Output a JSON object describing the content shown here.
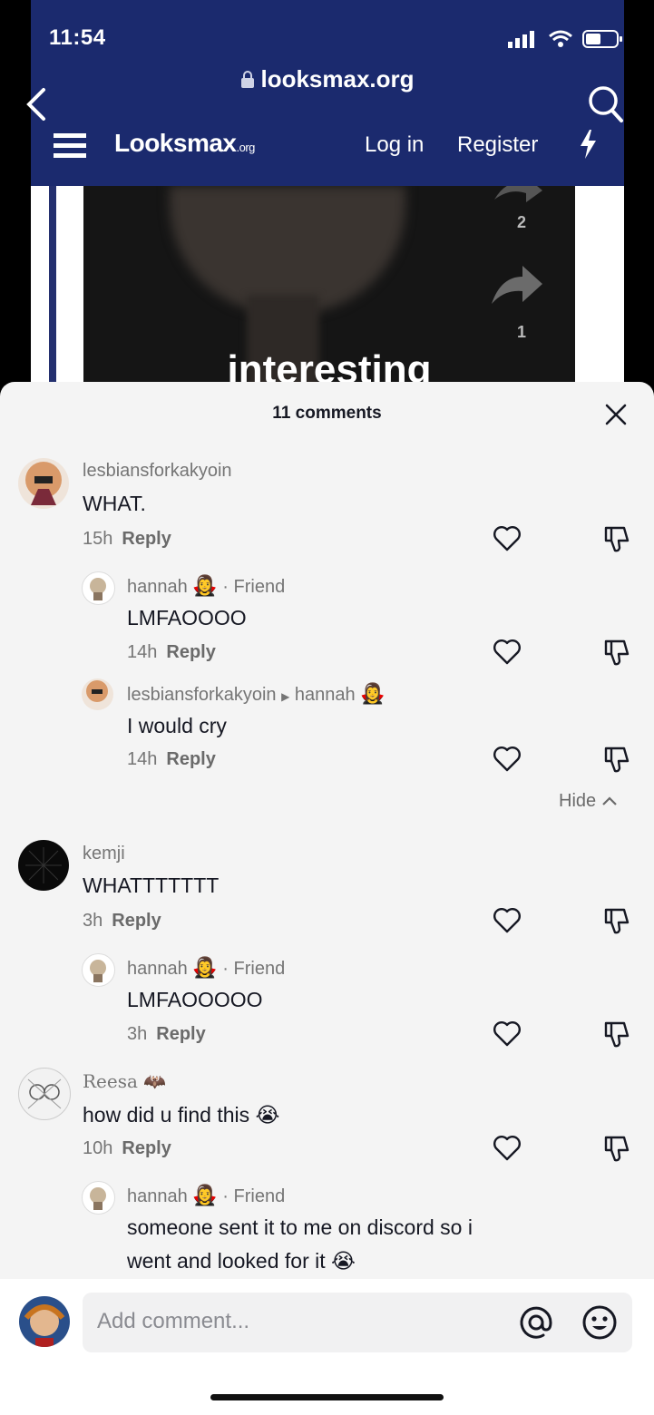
{
  "status": {
    "time": "11:54"
  },
  "browser": {
    "url": "looksmax.org"
  },
  "site": {
    "logo": "Looksmax",
    "logo_suffix": ".org",
    "login": "Log in",
    "register": "Register"
  },
  "video": {
    "caption": "interesting",
    "share_count_top": "2",
    "share_count": "1"
  },
  "comments_sheet": {
    "title": "11 comments",
    "comments": [
      {
        "user": "lesbiansforkakyoin",
        "text": "WHAT.",
        "time": "15h",
        "reply": "Reply"
      },
      {
        "user": "hannah",
        "friend_tag": "· Friend",
        "text": "LMFAOOOO",
        "time": "14h",
        "reply": "Reply"
      },
      {
        "user": "lesbiansforkakyoin",
        "reply_to": "hannah",
        "text": "I would cry",
        "time": "14h",
        "reply": "Reply"
      },
      {
        "user": "kemji",
        "text": "WHATTTTTTT",
        "time": "3h",
        "reply": "Reply"
      },
      {
        "user": "hannah",
        "friend_tag": "· Friend",
        "text": "LMFAOOOOO",
        "time": "3h",
        "reply": "Reply"
      },
      {
        "user": "Reesa",
        "text": "how did u find this",
        "time": "10h",
        "reply": "Reply"
      },
      {
        "user": "hannah",
        "friend_tag": "· Friend",
        "text_line1": "someone sent it to me on discord so i",
        "text_line2": "went and looked for it"
      }
    ],
    "hide_label": "Hide"
  },
  "composer": {
    "placeholder": "Add comment..."
  },
  "colors": {
    "header_bg": "#1b2a6e",
    "sheet_bg": "#f4f4f4",
    "text": "#161823",
    "muted": "#757575"
  }
}
